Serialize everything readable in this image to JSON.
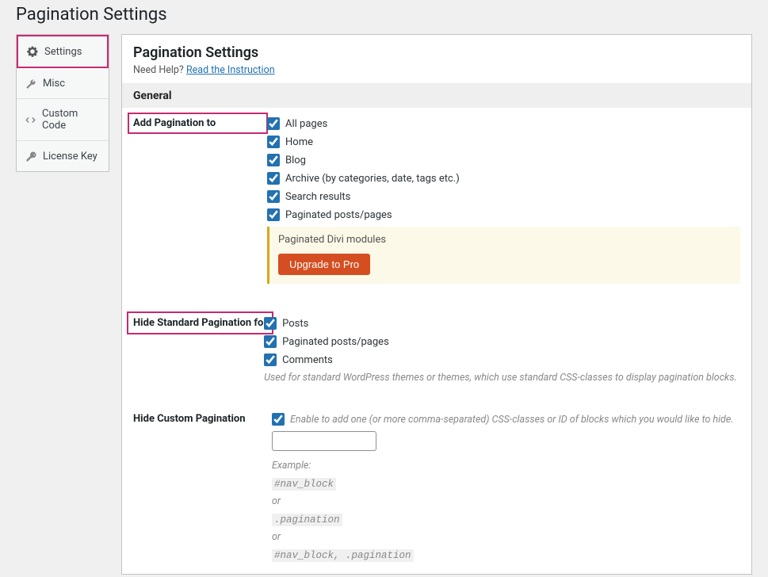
{
  "page": {
    "title": "Pagination Settings"
  },
  "sidebar": {
    "items": [
      {
        "label": "Settings",
        "icon": "gear-icon",
        "active": true
      },
      {
        "label": "Misc",
        "icon": "wrench-icon",
        "active": false
      },
      {
        "label": "Custom Code",
        "icon": "code-icon",
        "active": false
      },
      {
        "label": "License Key",
        "icon": "key-icon",
        "active": false
      }
    ]
  },
  "panel": {
    "heading": "Pagination Settings",
    "help_prefix": "Need Help? ",
    "help_link": "Read the Instruction"
  },
  "section": {
    "general": "General"
  },
  "row_addpagination": {
    "label": "Add Pagination to",
    "options": {
      "all_pages": "All pages",
      "home": "Home",
      "blog": "Blog",
      "archive": "Archive (by categories, date, tags etc.)",
      "search": "Search results",
      "paginated": "Paginated posts/pages"
    },
    "pro_notice": {
      "text": "Paginated Divi modules",
      "button": "Upgrade to Pro"
    }
  },
  "row_hidestandard": {
    "label": "Hide Standard Pagination for",
    "options": {
      "posts": "Posts",
      "paginated": "Paginated posts/pages",
      "comments": "Comments"
    },
    "help": "Used for standard WordPress themes or themes, which use standard CSS-classes to display pagination blocks."
  },
  "row_hidecustom": {
    "label": "Hide Custom Pagination",
    "cb_help": "Enable to add one (or more comma-separated) CSS-classes or ID of blocks which you would like to hide.",
    "input_value": "",
    "example": {
      "intro": "Example:",
      "code1": "#nav_block",
      "or1": "or",
      "code2": ".pagination",
      "or2": "or",
      "code3": "#nav_block, .pagination"
    }
  }
}
